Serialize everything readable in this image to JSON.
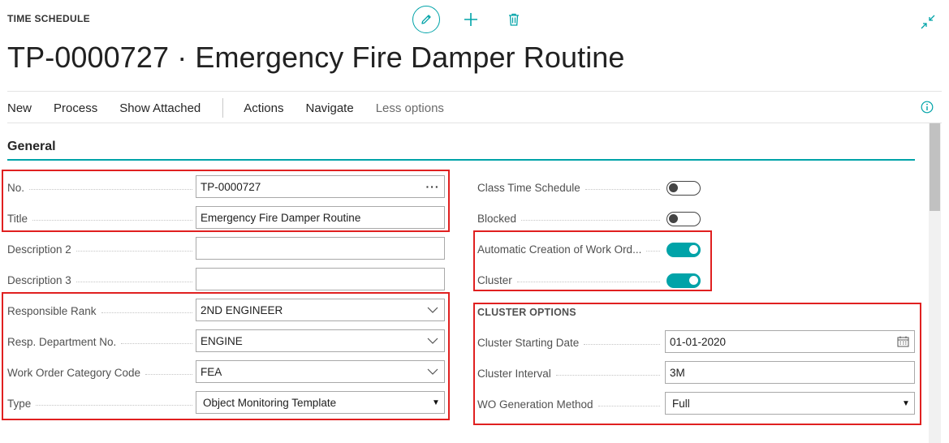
{
  "header": {
    "caption": "TIME SCHEDULE",
    "title": "TP-0000727 · Emergency Fire Damper Routine"
  },
  "icons": {
    "edit": "pencil-icon",
    "new": "plus-icon",
    "delete": "trash-icon",
    "collapse": "collapse-arrows-icon",
    "info": "info-icon",
    "calendar": "calendar-icon",
    "accent_color": "#00a3a8",
    "highlight_color": "#e02020"
  },
  "actionbar": {
    "new": "New",
    "process": "Process",
    "show_attached": "Show Attached",
    "actions": "Actions",
    "navigate": "Navigate",
    "less_options": "Less options"
  },
  "section": {
    "title": "General"
  },
  "left_fields": {
    "no": {
      "label": "No.",
      "value": "TP-0000727"
    },
    "title": {
      "label": "Title",
      "value": "Emergency Fire Damper Routine"
    },
    "description2": {
      "label": "Description 2",
      "value": ""
    },
    "description3": {
      "label": "Description 3",
      "value": ""
    },
    "responsible_rank": {
      "label": "Responsible Rank",
      "value": "2ND ENGINEER"
    },
    "resp_department": {
      "label": "Resp. Department No.",
      "value": "ENGINE"
    },
    "wo_category": {
      "label": "Work Order Category Code",
      "value": "FEA"
    },
    "type": {
      "label": "Type",
      "value": "Object Monitoring Template"
    }
  },
  "right_fields": {
    "class_time_schedule": {
      "label": "Class Time Schedule",
      "on": false
    },
    "blocked": {
      "label": "Blocked",
      "on": false
    },
    "auto_creation": {
      "label": "Automatic Creation of Work Ord...",
      "on": true
    },
    "cluster": {
      "label": "Cluster",
      "on": true
    }
  },
  "cluster_options": {
    "title": "CLUSTER OPTIONS",
    "starting_date": {
      "label": "Cluster Starting Date",
      "value": "01-01-2020"
    },
    "interval": {
      "label": "Cluster Interval",
      "value": "3M"
    },
    "wo_generation": {
      "label": "WO Generation Method",
      "value": "Full"
    }
  }
}
